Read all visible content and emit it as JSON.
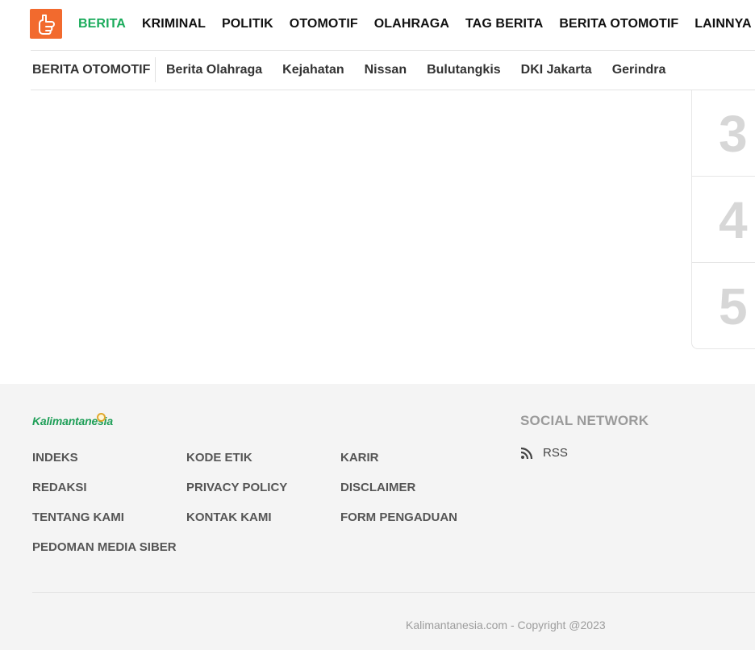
{
  "brand": {
    "logo_icon": "thumbs-up-icon",
    "accent": "#f26a2e"
  },
  "nav": {
    "items": [
      {
        "label": "BERITA",
        "active": true
      },
      {
        "label": "KRIMINAL"
      },
      {
        "label": "POLITIK"
      },
      {
        "label": "OTOMOTIF"
      },
      {
        "label": "OLAHRAGA"
      },
      {
        "label": "TAG BERITA"
      },
      {
        "label": "BERITA OTOMOTIF"
      },
      {
        "label": "LAINNYA",
        "icon": "chevron-down-icon"
      }
    ],
    "active_color": "#1aab5b"
  },
  "tags": {
    "first": "BERITA OTOMOTIF",
    "items": [
      "Berita Olahraga",
      "Kejahatan",
      "Nissan",
      "Bulutangkis",
      "DKI Jakarta",
      "Gerindra"
    ]
  },
  "ranking": {
    "numbers": [
      "3",
      "4",
      "5"
    ]
  },
  "footer": {
    "logo_text": "Kalimantanesia",
    "links": {
      "col1": [
        "INDEKS",
        "REDAKSI",
        "TENTANG KAMI",
        "PEDOMAN MEDIA SIBER"
      ],
      "col2": [
        "KODE ETIK",
        "PRIVACY POLICY",
        "KONTAK KAMI"
      ],
      "col3": [
        "KARIR",
        "DISCLAIMER",
        "FORM PENGADUAN"
      ]
    },
    "social_title": "SOCIAL NETWORK",
    "rss_label": "RSS",
    "rss_icon": "rss-icon",
    "copyright": "Kalimantanesia.com - Copyright @2023"
  }
}
